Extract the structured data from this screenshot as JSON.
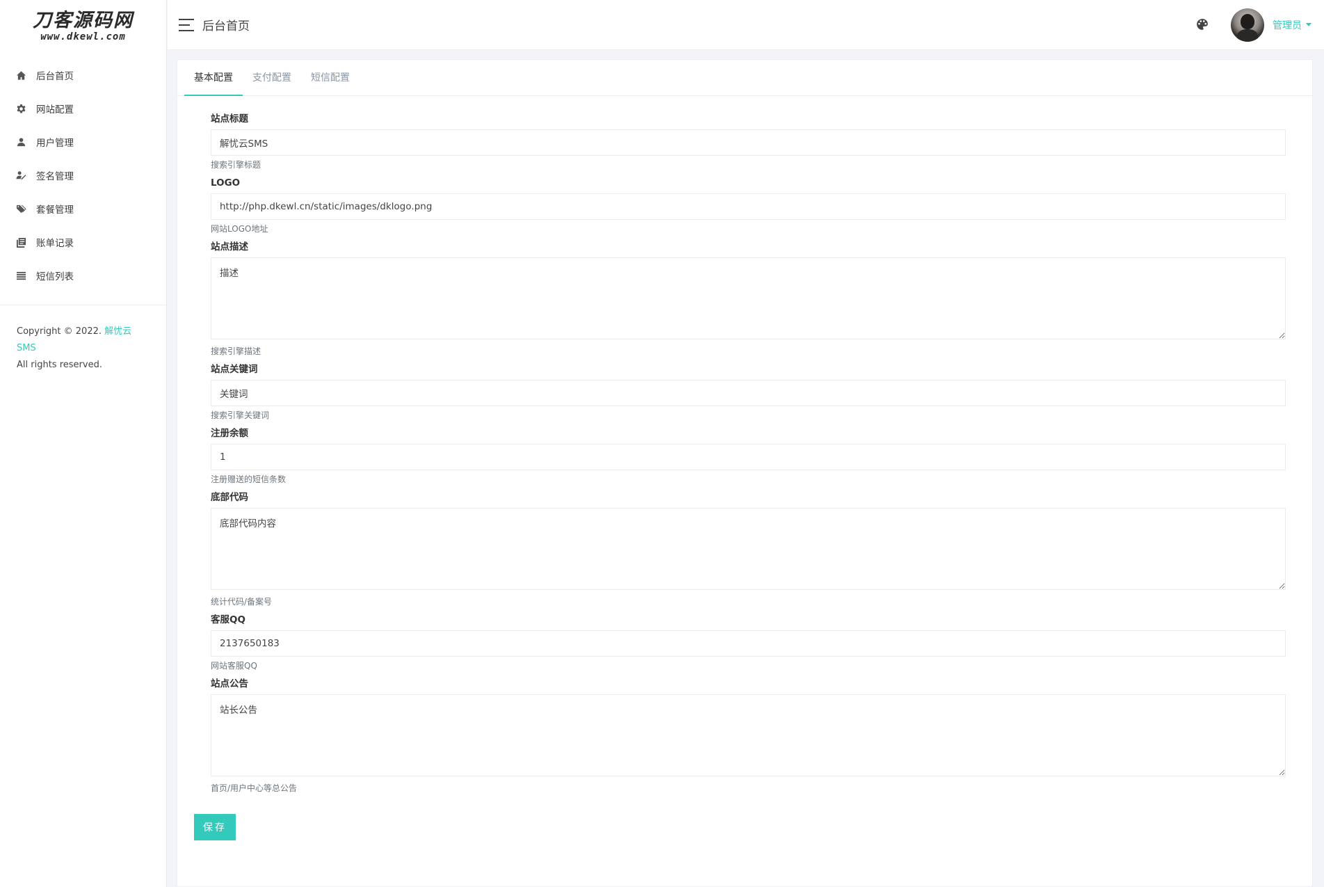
{
  "brand": {
    "main": "刀客源码网",
    "sub": "www.dkewl.com"
  },
  "sidebar": {
    "items": [
      {
        "label": "后台首页",
        "icon": "home-icon"
      },
      {
        "label": "网站配置",
        "icon": "gear-icon"
      },
      {
        "label": "用户管理",
        "icon": "user-icon"
      },
      {
        "label": "签名管理",
        "icon": "signature-icon"
      },
      {
        "label": "套餐管理",
        "icon": "tags-icon"
      },
      {
        "label": "账单记录",
        "icon": "book-icon"
      },
      {
        "label": "短信列表",
        "icon": "list-icon"
      }
    ],
    "copyright_prefix": "Copyright © 2022.",
    "copyright_link": "解忧云SMS",
    "copyright_suffix": "All rights reserved."
  },
  "header": {
    "title": "后台首页",
    "user": "管理员",
    "accent": "#33cabb"
  },
  "tabs": [
    {
      "label": "基本配置",
      "active": true
    },
    {
      "label": "支付配置",
      "active": false
    },
    {
      "label": "短信配置",
      "active": false
    }
  ],
  "form": {
    "site_title": {
      "label": "站点标题",
      "value": "解忧云SMS",
      "help": "搜索引擎标题"
    },
    "logo": {
      "label": "LOGO",
      "value": "http://php.dkewl.cn/static/images/dklogo.png",
      "help": "网站LOGO地址"
    },
    "description": {
      "label": "站点描述",
      "value": "描述",
      "help": "搜索引擎描述"
    },
    "keywords": {
      "label": "站点关键词",
      "value": "关键词",
      "help": "搜索引擎关键词"
    },
    "register_balance": {
      "label": "注册余额",
      "value": "1",
      "help": "注册赠送的短信条数"
    },
    "footer_code": {
      "label": "底部代码",
      "value": "底部代码内容",
      "help": "统计代码/备案号"
    },
    "service_qq": {
      "label": "客服QQ",
      "value": "2137650183",
      "help": "网站客服QQ"
    },
    "notice": {
      "label": "站点公告",
      "value": "站长公告",
      "help": "首页/用户中心等总公告"
    },
    "save_label": "保存"
  }
}
